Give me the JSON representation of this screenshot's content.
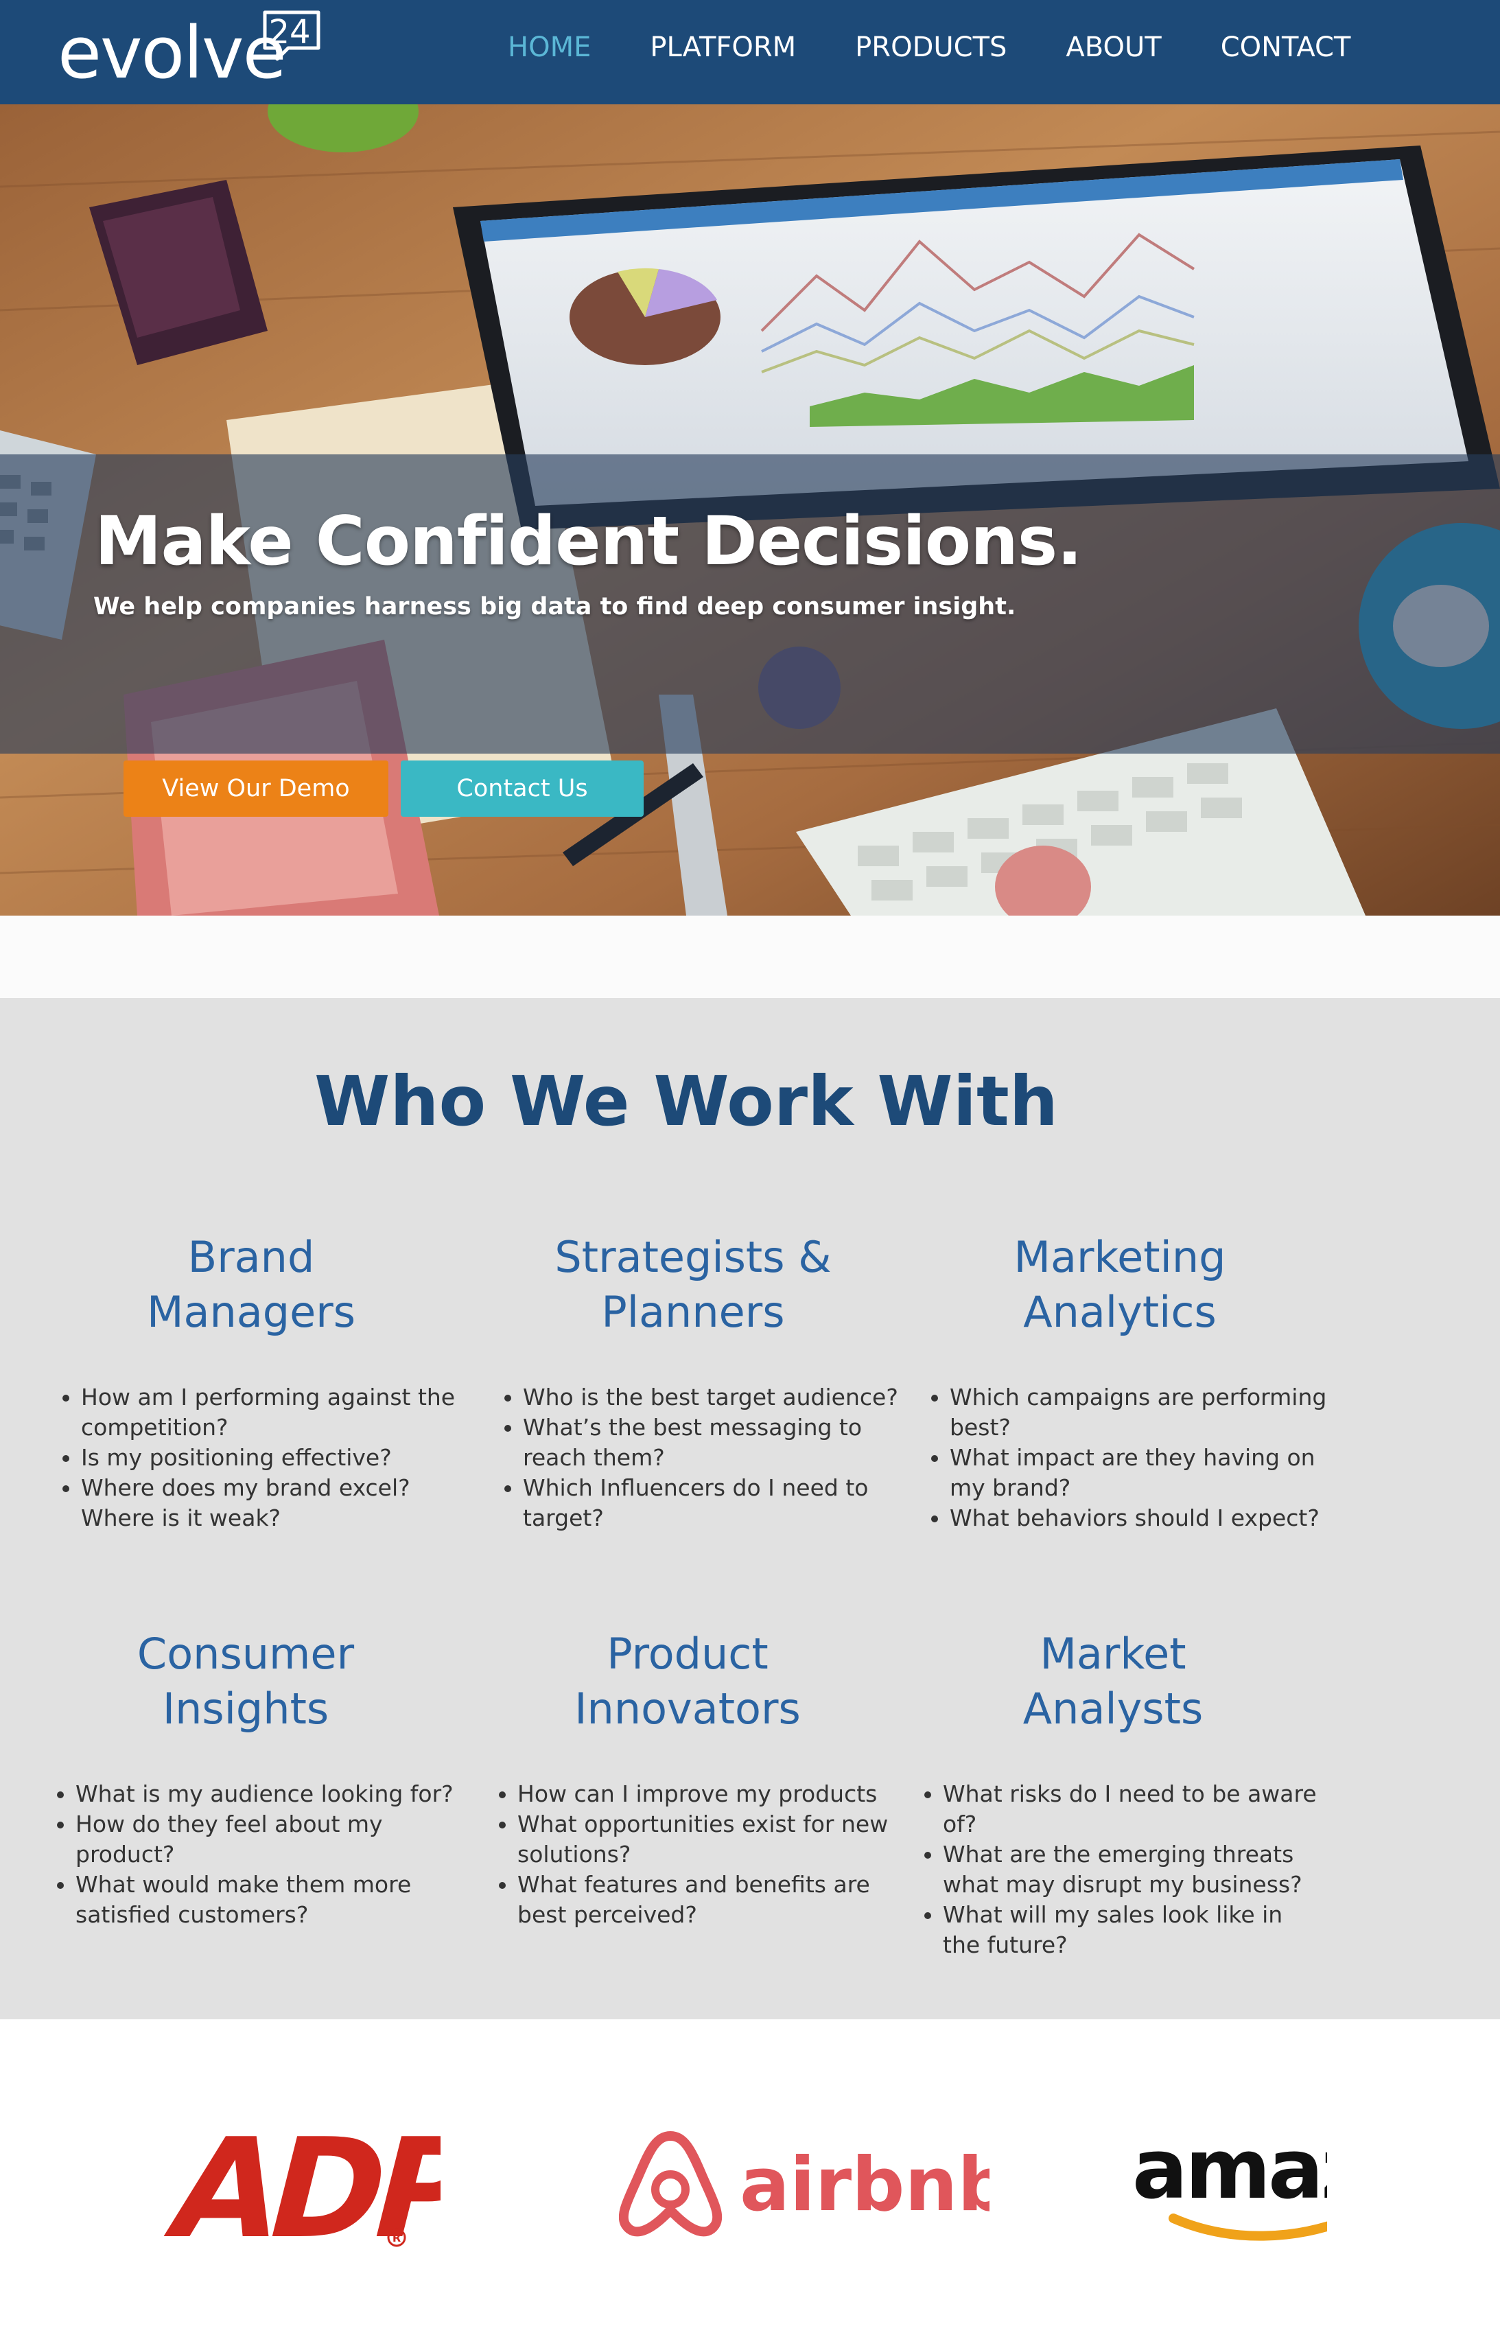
{
  "brand": {
    "name": "evolve",
    "badge": "24"
  },
  "nav": {
    "items": [
      {
        "label": "HOME",
        "active": true
      },
      {
        "label": "PLATFORM",
        "active": false
      },
      {
        "label": "PRODUCTS",
        "active": false
      },
      {
        "label": "ABOUT",
        "active": false
      },
      {
        "label": "CONTACT",
        "active": false
      }
    ]
  },
  "hero": {
    "title": "Make Confident Decisions.",
    "subtitle": "We help companies harness big data to find deep consumer insight.",
    "demo_button": "View Our Demo",
    "contact_button": "Contact Us"
  },
  "who": {
    "title": "Who We Work With",
    "columns": [
      {
        "title_line1": "Brand",
        "title_line2": "Managers",
        "items": [
          "How am I performing against the competition?",
          "Is my positioning effective?",
          "Where does my brand excel? Where is it weak?"
        ]
      },
      {
        "title_line1": "Strategists &",
        "title_line2": "Planners",
        "items": [
          "Who is the best target audience?",
          "What’s the best messaging to reach them?",
          "Which Influencers do I need to target?"
        ]
      },
      {
        "title_line1": "Marketing",
        "title_line2": "Analytics",
        "items": [
          "Which campaigns are performing best?",
          "What impact are they having on my brand?",
          "What behaviors should I expect?"
        ]
      },
      {
        "title_line1": "Consumer",
        "title_line2": "Insights",
        "items": [
          "What is my audience looking for?",
          "How do they feel about my product?",
          "What would make them more satisfied customers?"
        ]
      },
      {
        "title_line1": "Product",
        "title_line2": "Innovators",
        "items": [
          "How can I improve my products",
          "What opportunities exist for new solutions?",
          "What features and benefits are best perceived?"
        ]
      },
      {
        "title_line1": "Market",
        "title_line2": "Analysts",
        "items": [
          "What risks do I need to be aware of?",
          "What are the emerging threats what may disrupt my business?",
          "What will my sales look like in the future?"
        ]
      }
    ]
  },
  "clients": {
    "logos": [
      {
        "name": "ADP",
        "text": "ADP",
        "color": "#d0271d"
      },
      {
        "name": "airbnb",
        "text": "airbnb",
        "color": "#e0565b"
      },
      {
        "name": "amazon",
        "text": "amaz",
        "color": "#111111",
        "accent": "#f0a21a"
      }
    ]
  },
  "colors": {
    "nav_bg": "#1d4a78",
    "nav_active": "#5bb7d6",
    "demo_button": "#ec8217",
    "contact_button": "#3ab8c4",
    "section_bg": "#e1e1e1",
    "heading": "#1d4a78",
    "subheading": "#2a63a2"
  }
}
